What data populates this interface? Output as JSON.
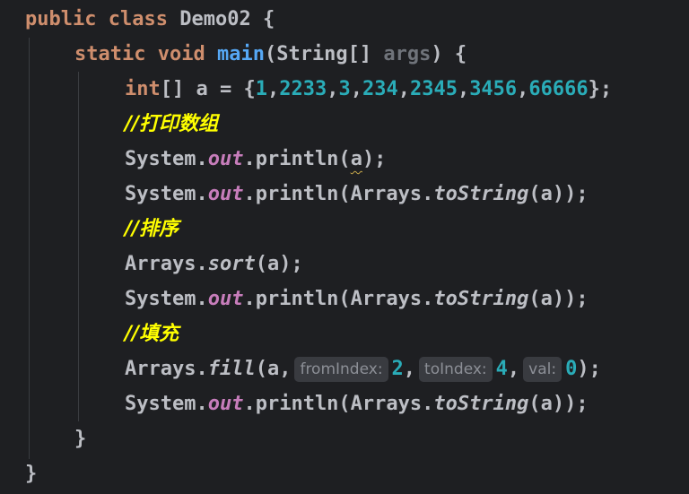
{
  "colors": {
    "background": "#1e1f22",
    "keyword": "#cf8e6d",
    "method": "#56a8f5",
    "number": "#2aacb8",
    "field": "#c77dbb",
    "comment": "#ffff00",
    "text": "#bcbec4",
    "hint_bg": "#393b40"
  },
  "code": {
    "l1": {
      "kw1": "public",
      "kw2": "class",
      "name": "Demo02",
      "brace": "{"
    },
    "l2": {
      "kw1": "static",
      "kw2": "void",
      "fn": "main",
      "p1": "(String[]",
      "param": "args",
      "p2": ") {"
    },
    "l3": {
      "kw": "int",
      "rest": "[] a = {",
      "n1": "1",
      "n2": "2233",
      "n3": "3",
      "n4": "234",
      "n5": "2345",
      "n6": "3456",
      "n7": "66666",
      "end": "};"
    },
    "l4": {
      "comment": "//打印数组"
    },
    "l5": {
      "sys": "System.",
      "out": "out",
      "call": ".println(",
      "arg": "a",
      "end": ");"
    },
    "l6": {
      "sys": "System.",
      "out": "out",
      "call": ".println(Arrays.",
      "method": "toString",
      "end": "(a));"
    },
    "l7": {
      "comment": "//排序"
    },
    "l8": {
      "cls": "Arrays.",
      "method": "sort",
      "end": "(a);"
    },
    "l9": {
      "sys": "System.",
      "out": "out",
      "call": ".println(Arrays.",
      "method": "toString",
      "end": "(a));"
    },
    "l10": {
      "comment": "//填充"
    },
    "l11": {
      "cls": "Arrays.",
      "method": "fill",
      "open": "(a,",
      "hint1": "fromIndex:",
      "v1": "2",
      "hint2": "toIndex:",
      "v2": "4",
      "hint3": "val:",
      "v3": "0",
      "end": ");"
    },
    "l12": {
      "sys": "System.",
      "out": "out",
      "call": ".println(Arrays.",
      "method": "toString",
      "end": "(a));"
    },
    "l13": {
      "brace": "}"
    },
    "l14": {
      "brace": "}"
    }
  }
}
